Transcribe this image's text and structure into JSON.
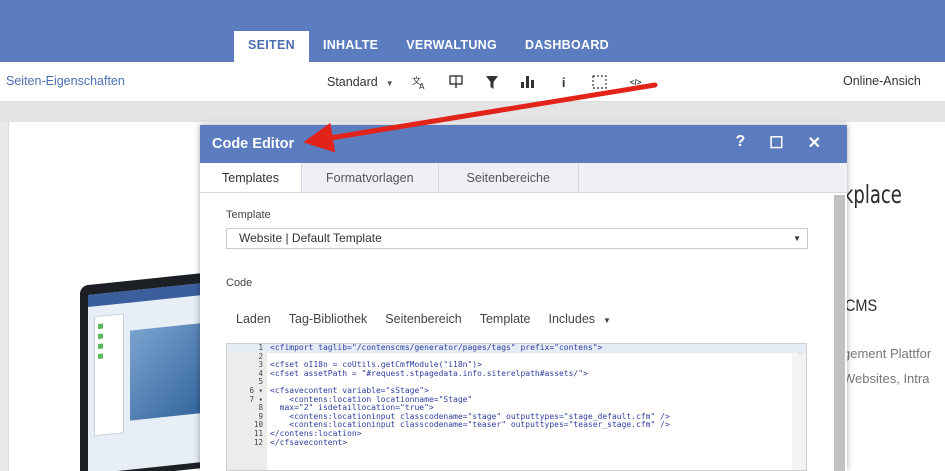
{
  "topnav": {
    "tabs": [
      {
        "label": "SEITEN"
      },
      {
        "label": "INHALTE"
      },
      {
        "label": "VERWALTUNG"
      },
      {
        "label": "DASHBOARD"
      }
    ]
  },
  "toolbar": {
    "page_properties": "Seiten-Eigenschaften",
    "view_mode": "Standard",
    "icons": [
      "translate-icon",
      "comment-icon",
      "filter-icon",
      "bar-chart-icon",
      "info-icon",
      "selection-frame-icon",
      "code-icon"
    ],
    "info_glyph": "i",
    "code_glyph": "</>",
    "online_view": "Online-Ansich"
  },
  "background_page": {
    "heading": "kplace",
    "subheading": "CMS",
    "line1": "gement Plattfor",
    "line2": "Websites, Intra"
  },
  "code_editor": {
    "title": "Code Editor",
    "controls": {
      "help": "?",
      "maximize": "☐",
      "close": "✕"
    },
    "tabs": [
      "Templates",
      "Formatvorlagen",
      "Seitenbereiche"
    ],
    "template_label": "Template",
    "template_value": "Website | Default Template",
    "code_label": "Code",
    "menu": {
      "load": "Laden",
      "tag_library": "Tag-Bibliothek",
      "page_area": "Seitenbereich",
      "template": "Template",
      "includes": "Includes"
    },
    "code_lines": [
      {
        "n": "1",
        "text": "<cfimport taglib=\"/contenscms/generator/pages/tags\" prefix=\"contens\">"
      },
      {
        "n": "2",
        "text": ""
      },
      {
        "n": "3",
        "text": "<cfset oI18n = coUtils.getCmfModule(\"i18n\")>"
      },
      {
        "n": "4",
        "text": "<cfset assetPath = \"#request.stpagedata.info.siterelpath#assets/\">"
      },
      {
        "n": "5",
        "text": ""
      },
      {
        "n": "6 ▾",
        "text": "<cfsavecontent variable=\"sStage\">"
      },
      {
        "n": "7 ▾",
        "text": "    <contens:location locationname=\"Stage\""
      },
      {
        "n": "8",
        "text": "  max=\"2\" isdetaillocation=\"true\">"
      },
      {
        "n": "9",
        "text": "    <contens:locationinput classcodename=\"stage\" outputtypes=\"stage_default.cfm\" />"
      },
      {
        "n": "10",
        "text": "    <contens:locationinput classcodename=\"teaser\" outputtypes=\"teaser_stage.cfm\" />"
      },
      {
        "n": "11",
        "text": "</contens:location>"
      },
      {
        "n": "12",
        "text": "</cfsavecontent>"
      }
    ]
  },
  "colors": {
    "brand_blue": "#5b7dbf",
    "annotation_arrow": "#e2231a"
  }
}
